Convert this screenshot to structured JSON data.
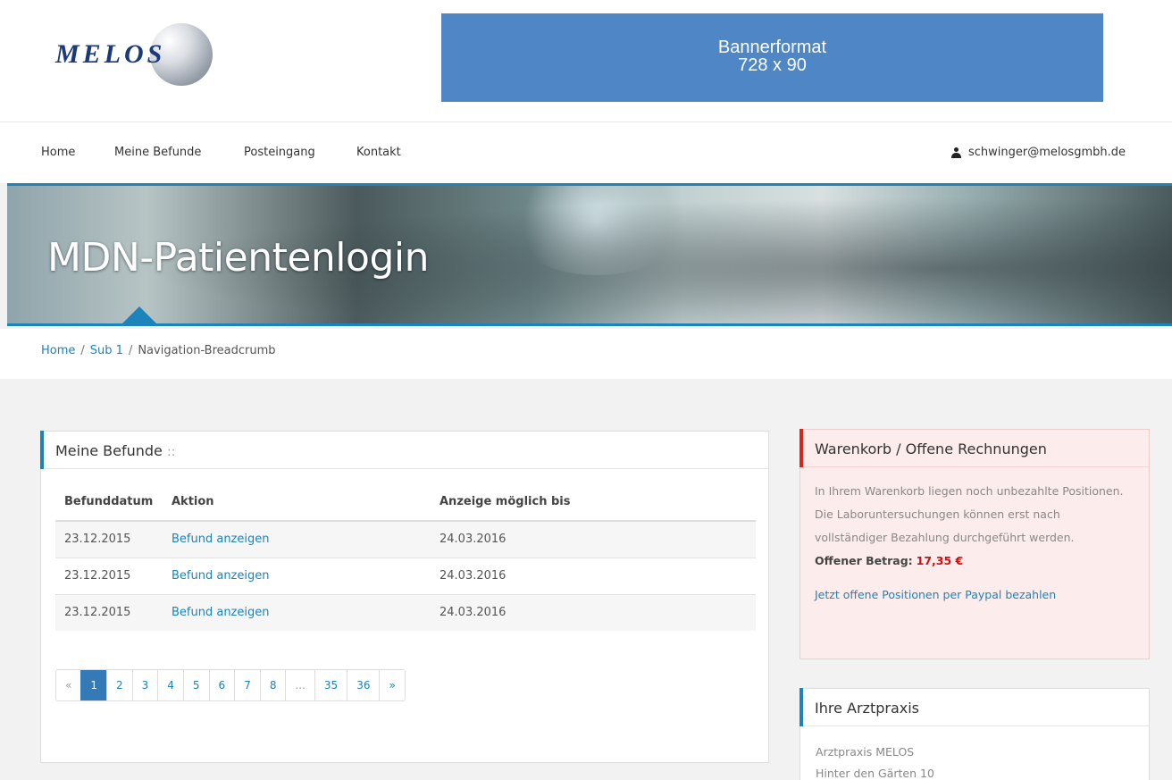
{
  "header": {
    "logo_text": "MELOS",
    "banner_line1": "Bannerformat",
    "banner_line2": "728 x 90"
  },
  "nav": {
    "items": [
      "Home",
      "Meine Befunde",
      "Posteingang",
      "Kontakt"
    ],
    "user_email": "schwinger@melosgmbh.de",
    "user_icon": "user-icon"
  },
  "hero": {
    "title": "MDN-Patientenlogin"
  },
  "breadcrumb": {
    "items": [
      "Home",
      "Sub 1",
      "Navigation-Breadcrumb"
    ],
    "separator": "/"
  },
  "befunde": {
    "title": "Meine Befunde",
    "title_suffix": "::",
    "columns": [
      "Befunddatum",
      "Aktion",
      "Anzeige möglich bis"
    ],
    "rows": [
      {
        "date": "23.12.2015",
        "action": "Befund anzeigen",
        "until": "24.03.2016"
      },
      {
        "date": "23.12.2015",
        "action": "Befund anzeigen",
        "until": "24.03.2016"
      },
      {
        "date": "23.12.2015",
        "action": "Befund anzeigen",
        "until": "24.03.2016"
      }
    ],
    "pagination": [
      "«",
      "1",
      "2",
      "3",
      "4",
      "5",
      "6",
      "7",
      "8",
      "...",
      "35",
      "36",
      "»"
    ],
    "current_page": "1"
  },
  "cart": {
    "title": "Warenkorb / Offene Rechnungen",
    "text": "In Ihrem Warenkorb liegen noch unbezahlte Positionen. Die Laboruntersuchungen können erst nach vollständiger Bezahlung durchgeführt werden.",
    "amount_label": "Offener Betrag:",
    "amount": "17,35 €",
    "pay_link": "Jetzt offene Positionen per Paypal bezahlen",
    "accent_color": "#d9261c"
  },
  "praxis": {
    "title": "Ihre Arztpraxis",
    "lines": [
      "Arztpraxis MELOS",
      "Hinter den Gärten 10"
    ]
  },
  "colors": {
    "primary": "#1c83bb",
    "banner": "#4f86c6"
  }
}
